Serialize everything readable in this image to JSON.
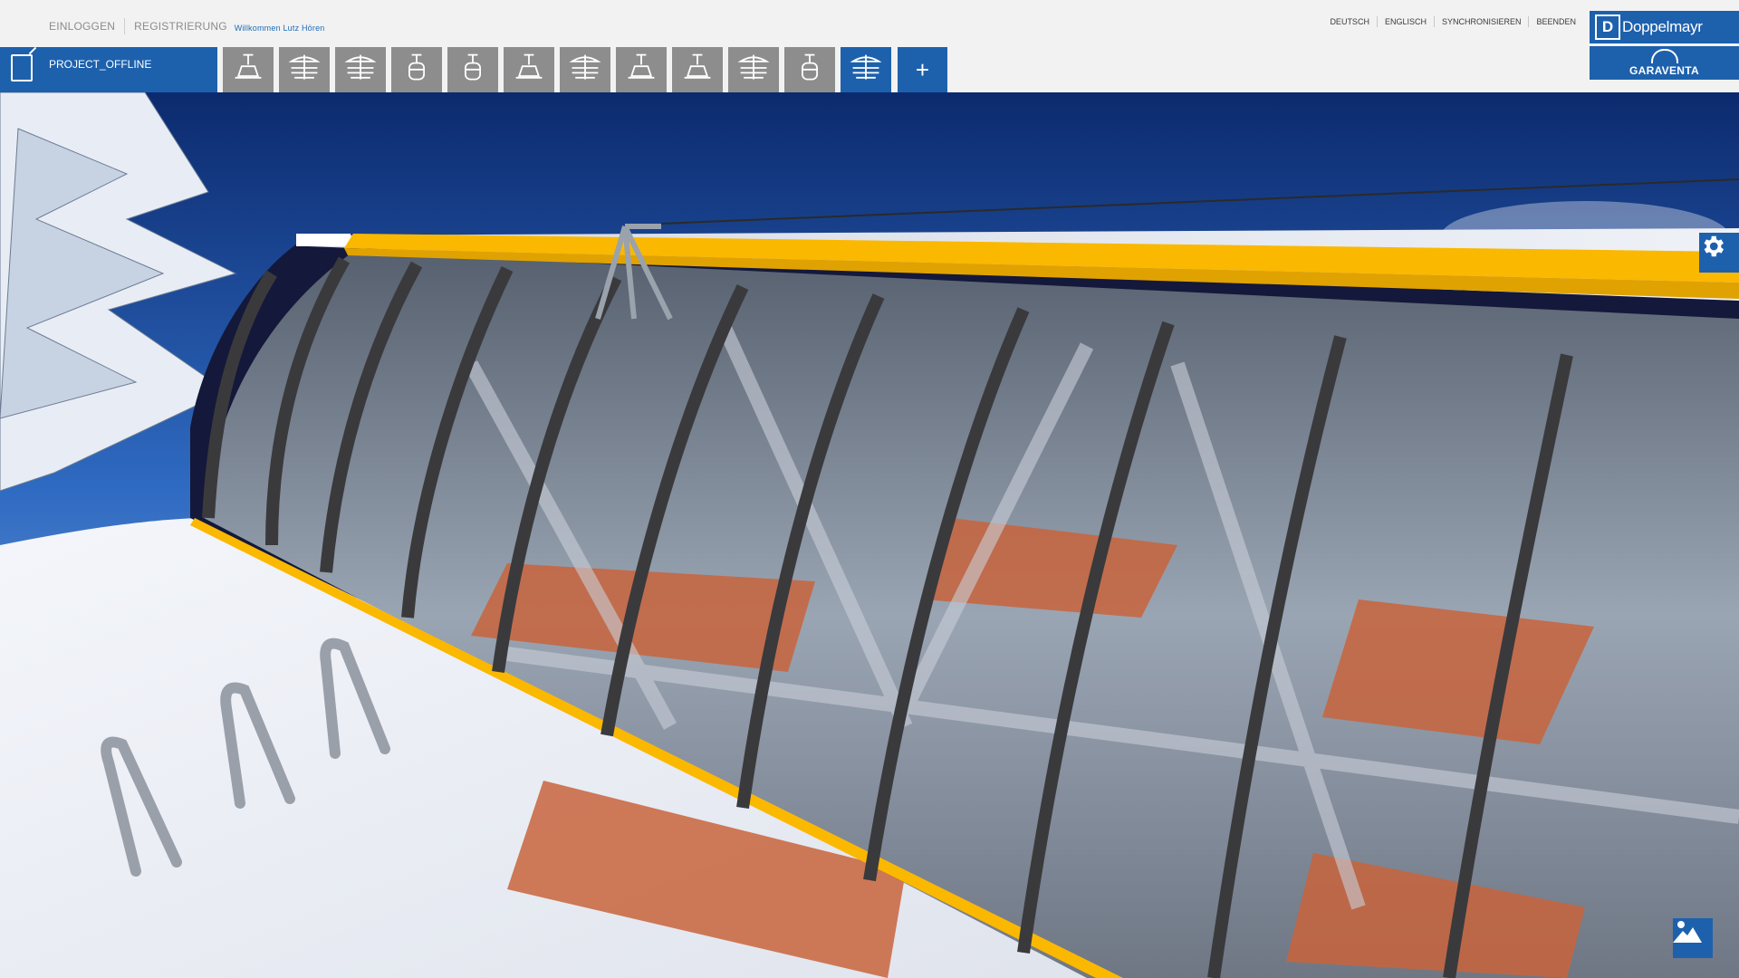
{
  "header": {
    "login_label": "EINLOGGEN",
    "register_label": "REGISTRIERUNG",
    "welcome_text": "Willkommen Lutz Hören",
    "lang_de": "DEUTSCH",
    "lang_en": "ENGLISCH",
    "sync_label": "SYNCHRONISIEREN",
    "exit_label": "BEENDEN"
  },
  "brand": {
    "logo_primary": "Doppelmayr",
    "logo_secondary": "GARAVENTA",
    "primary_color": "#1d61ad"
  },
  "project": {
    "name": "PROJECT_OFFLINE",
    "icon": "document-edit-icon"
  },
  "toolbar": {
    "tabs": [
      {
        "icon": "chairlift-icon",
        "active": false
      },
      {
        "icon": "chairlift-hood-icon",
        "active": false
      },
      {
        "icon": "chairlift-hood-icon",
        "active": false
      },
      {
        "icon": "gondola-icon",
        "active": false
      },
      {
        "icon": "gondola-icon",
        "active": false
      },
      {
        "icon": "chairlift-icon",
        "active": false
      },
      {
        "icon": "chairlift-hood-icon",
        "active": false
      },
      {
        "icon": "chairlift-icon",
        "active": false
      },
      {
        "icon": "chairlift-icon",
        "active": false
      },
      {
        "icon": "chairlift-hood-icon",
        "active": false
      },
      {
        "icon": "gondola-icon",
        "active": false
      },
      {
        "icon": "chairlift-hood-icon",
        "active": true
      }
    ],
    "add_label": "+"
  },
  "scene": {
    "description_icons": [
      "settings-icon",
      "image-icon"
    ]
  }
}
